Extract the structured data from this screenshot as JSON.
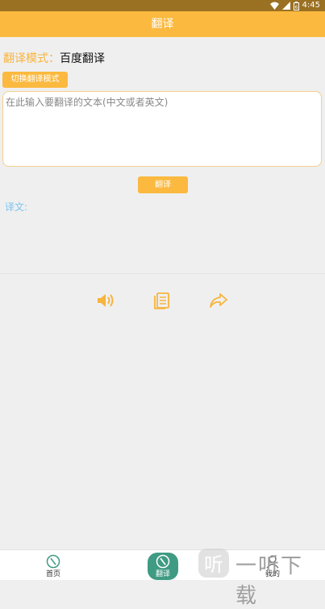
{
  "status_bar": {
    "time": "4:45",
    "battery_level": "6"
  },
  "app_bar": {
    "title": "翻译"
  },
  "mode": {
    "label": "翻译模式：",
    "value": "百度翻译"
  },
  "switch_button": {
    "label": "切换翻译模式"
  },
  "input": {
    "placeholder": "在此输入要翻译的文本(中文或者英文)",
    "value": ""
  },
  "translate_button": {
    "label": "翻译"
  },
  "result": {
    "label": "译文:"
  },
  "actions": [
    {
      "name": "speaker-icon"
    },
    {
      "name": "copy-icon"
    },
    {
      "name": "share-icon"
    }
  ],
  "bottom_nav": {
    "items": [
      {
        "label": "首页",
        "active": false
      },
      {
        "label": "翻译",
        "active": true
      },
      {
        "label": "我的",
        "active": false
      }
    ]
  },
  "watermark": {
    "text": "一听下载",
    "logo": "听"
  },
  "colors": {
    "accent": "#fbb93f",
    "status_bar": "#9a7022",
    "link_blue": "#79c5f4",
    "active_nav": "#3f9b83"
  }
}
